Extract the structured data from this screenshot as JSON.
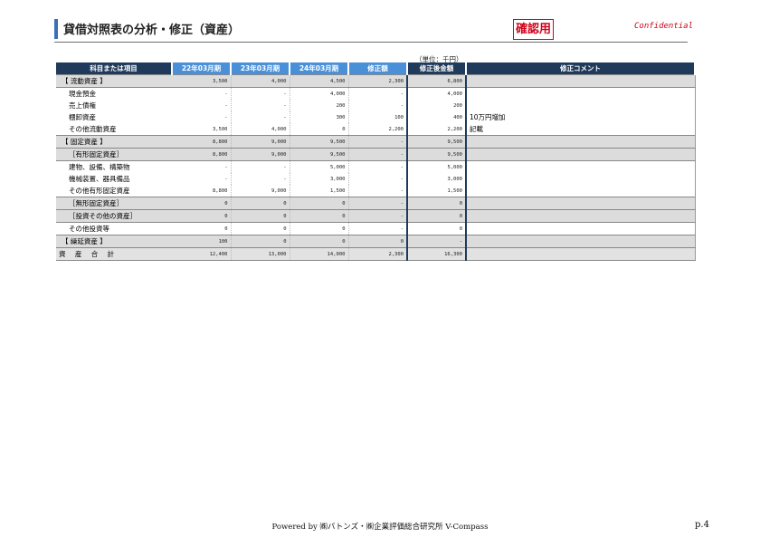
{
  "header": {
    "title": "貸借対照表の分析・修正（資産）",
    "stamp": "確認用",
    "confidential": "Confidential"
  },
  "unit_label": "（単位：千円）",
  "table": {
    "columns": [
      "科目または項目",
      "22年03月期",
      "23年03月期",
      "24年03月期",
      "修正額",
      "修正後金額",
      "修正コメント"
    ],
    "rows": [
      {
        "label": "【 流動資産 】",
        "style": "shade",
        "indent": "lvl1",
        "v1": "3,500",
        "v2": "4,000",
        "v3": "4,500",
        "adj": "2,300",
        "after": "6,800",
        "comment": ""
      },
      {
        "label": "現金預金",
        "style": "white",
        "indent": "lvl2",
        "v1": "-",
        "v2": "-",
        "v3": "4,000",
        "adj": "-",
        "after": "4,000",
        "comment": ""
      },
      {
        "label": "売上債権",
        "style": "white",
        "indent": "lvl2",
        "v1": "-",
        "v2": "-",
        "v3": "200",
        "adj": "-",
        "after": "200",
        "comment": ""
      },
      {
        "label": "棚卸資産",
        "style": "white",
        "indent": "lvl2",
        "v1": "-",
        "v2": "-",
        "v3": "300",
        "adj": "100",
        "after": "400",
        "comment": "10万円増加"
      },
      {
        "label": "その他流動資産",
        "style": "white",
        "indent": "lvl2",
        "v1": "3,500",
        "v2": "4,000",
        "v3": "0",
        "adj": "2,200",
        "after": "2,200",
        "comment": "記載"
      },
      {
        "label": "【 固定資産 】",
        "style": "shade",
        "indent": "lvl1",
        "v1": "8,800",
        "v2": "9,000",
        "v3": "9,500",
        "adj": "-",
        "after": "9,500",
        "comment": ""
      },
      {
        "label": "［有形固定資産］",
        "style": "shade",
        "indent": "lvl2b",
        "v1": "8,800",
        "v2": "9,000",
        "v3": "9,500",
        "adj": "-",
        "after": "9,500",
        "comment": ""
      },
      {
        "label": "建物、設備、構築物",
        "style": "white",
        "indent": "lvl2",
        "v1": "-",
        "v2": "-",
        "v3": "5,000",
        "adj": "-",
        "after": "5,000",
        "comment": ""
      },
      {
        "label": "機械装置、器具備品",
        "style": "white",
        "indent": "lvl2",
        "v1": "-",
        "v2": "-",
        "v3": "3,000",
        "adj": "-",
        "after": "3,000",
        "comment": ""
      },
      {
        "label": "その他有形固定資産",
        "style": "white",
        "indent": "lvl2",
        "v1": "8,800",
        "v2": "9,000",
        "v3": "1,500",
        "adj": "-",
        "after": "1,500",
        "comment": ""
      },
      {
        "label": "［無形固定資産］",
        "style": "shade",
        "indent": "lvl2b",
        "v1": "0",
        "v2": "0",
        "v3": "0",
        "adj": "-",
        "after": "0",
        "comment": ""
      },
      {
        "label": "［投資その他の資産］",
        "style": "shade",
        "indent": "lvl2b",
        "v1": "0",
        "v2": "0",
        "v3": "0",
        "adj": "-",
        "after": "0",
        "comment": ""
      },
      {
        "label": "その他投資等",
        "style": "white",
        "indent": "lvl2",
        "v1": "0",
        "v2": "0",
        "v3": "0",
        "adj": "-",
        "after": "0",
        "comment": ""
      },
      {
        "label": "【 繰延資産 】",
        "style": "shade",
        "indent": "lvl1",
        "v1": "100",
        "v2": "0",
        "v3": "0",
        "adj": "0",
        "after": "-",
        "comment": ""
      },
      {
        "label": "資 産 合 計",
        "style": "total",
        "indent": "",
        "v1": "12,400",
        "v2": "13,000",
        "v3": "14,000",
        "adj": "2,300",
        "after": "16,300",
        "comment": ""
      }
    ]
  },
  "footer": {
    "text": "Powered by ㈱バトンズ・㈱企業評価総合研究所 V-Compass",
    "page": "p.4"
  }
}
